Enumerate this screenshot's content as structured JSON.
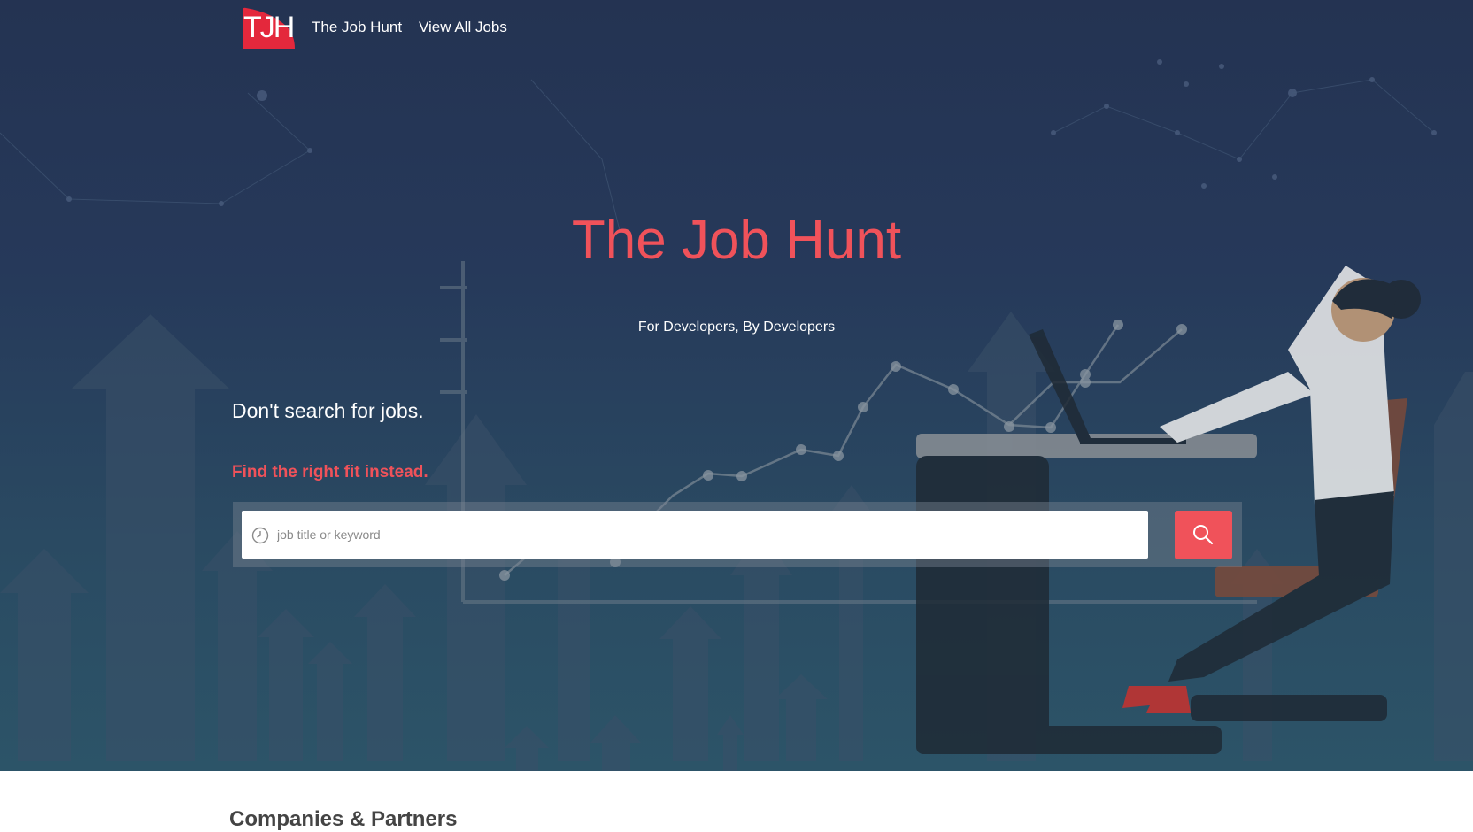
{
  "brand": {
    "logo_text": "TJH",
    "accent_color": "#f0525a",
    "background_color": "#243352"
  },
  "nav": {
    "links": [
      {
        "label": "The Job Hunt"
      },
      {
        "label": "View All Jobs"
      }
    ]
  },
  "hero": {
    "title": "The Job Hunt",
    "subtitle": "For Developers, By Developers",
    "tagline": "Don't search for jobs.",
    "tagline_accent": "Find the right fit instead."
  },
  "search": {
    "placeholder": "job title or keyword",
    "value": "",
    "input_icon": "clock-icon",
    "button_icon": "search-icon"
  },
  "section": {
    "heading": "Companies & Partners"
  }
}
